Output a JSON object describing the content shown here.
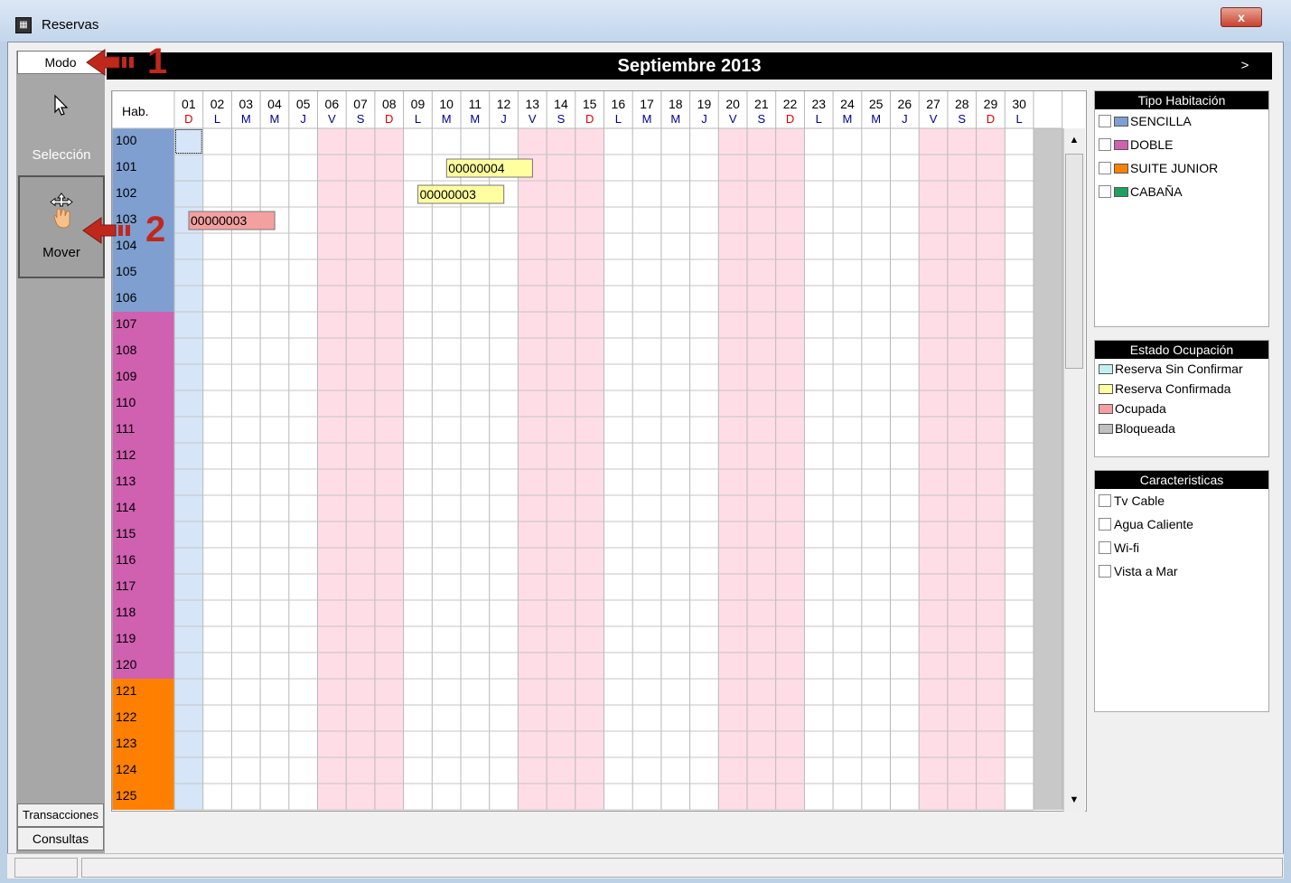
{
  "window": {
    "title": "Reservas",
    "close_label": "x"
  },
  "tabs": {
    "modo": "Modo",
    "transacciones": "Transacciones",
    "consultas": "Consultas"
  },
  "modes": {
    "seleccion": "Selección",
    "mover": "Mover"
  },
  "calendar": {
    "month_title": "Septiembre 2013",
    "next_label": ">",
    "room_header": "Hab.",
    "days": [
      {
        "n": "01",
        "w": "D"
      },
      {
        "n": "02",
        "w": "L"
      },
      {
        "n": "03",
        "w": "M"
      },
      {
        "n": "04",
        "w": "M"
      },
      {
        "n": "05",
        "w": "J"
      },
      {
        "n": "06",
        "w": "V"
      },
      {
        "n": "07",
        "w": "S"
      },
      {
        "n": "08",
        "w": "D"
      },
      {
        "n": "09",
        "w": "L"
      },
      {
        "n": "10",
        "w": "M"
      },
      {
        "n": "11",
        "w": "M"
      },
      {
        "n": "12",
        "w": "J"
      },
      {
        "n": "13",
        "w": "V"
      },
      {
        "n": "14",
        "w": "S"
      },
      {
        "n": "15",
        "w": "D"
      },
      {
        "n": "16",
        "w": "L"
      },
      {
        "n": "17",
        "w": "M"
      },
      {
        "n": "18",
        "w": "M"
      },
      {
        "n": "19",
        "w": "J"
      },
      {
        "n": "20",
        "w": "V"
      },
      {
        "n": "21",
        "w": "S"
      },
      {
        "n": "22",
        "w": "D"
      },
      {
        "n": "23",
        "w": "L"
      },
      {
        "n": "24",
        "w": "M"
      },
      {
        "n": "25",
        "w": "M"
      },
      {
        "n": "26",
        "w": "J"
      },
      {
        "n": "27",
        "w": "V"
      },
      {
        "n": "28",
        "w": "S"
      },
      {
        "n": "29",
        "w": "D"
      },
      {
        "n": "30",
        "w": "L"
      }
    ],
    "weekend_days": [
      "06",
      "07",
      "08",
      "13",
      "14",
      "15",
      "20",
      "21",
      "22",
      "27",
      "28",
      "29"
    ],
    "rooms": [
      {
        "num": "100",
        "type": "SENCILLA"
      },
      {
        "num": "101",
        "type": "SENCILLA"
      },
      {
        "num": "102",
        "type": "SENCILLA"
      },
      {
        "num": "103",
        "type": "SENCILLA"
      },
      {
        "num": "104",
        "type": "SENCILLA"
      },
      {
        "num": "105",
        "type": "SENCILLA"
      },
      {
        "num": "106",
        "type": "SENCILLA"
      },
      {
        "num": "107",
        "type": "DOBLE"
      },
      {
        "num": "108",
        "type": "DOBLE"
      },
      {
        "num": "109",
        "type": "DOBLE"
      },
      {
        "num": "110",
        "type": "DOBLE"
      },
      {
        "num": "111",
        "type": "DOBLE"
      },
      {
        "num": "112",
        "type": "DOBLE"
      },
      {
        "num": "113",
        "type": "DOBLE"
      },
      {
        "num": "114",
        "type": "DOBLE"
      },
      {
        "num": "115",
        "type": "DOBLE"
      },
      {
        "num": "116",
        "type": "DOBLE"
      },
      {
        "num": "117",
        "type": "DOBLE"
      },
      {
        "num": "118",
        "type": "DOBLE"
      },
      {
        "num": "119",
        "type": "DOBLE"
      },
      {
        "num": "120",
        "type": "DOBLE"
      },
      {
        "num": "121",
        "type": "SUITE JUNIOR"
      },
      {
        "num": "122",
        "type": "SUITE JUNIOR"
      },
      {
        "num": "123",
        "type": "SUITE JUNIOR"
      },
      {
        "num": "124",
        "type": "SUITE JUNIOR"
      },
      {
        "num": "125",
        "type": "SUITE JUNIOR"
      }
    ],
    "reservations": [
      {
        "code": "00000004",
        "room": "101",
        "start": "10",
        "days": 3,
        "state": "Reserva Confirmada"
      },
      {
        "code": "00000003",
        "room": "102",
        "start": "09",
        "days": 3,
        "state": "Reserva Confirmada"
      },
      {
        "code": "00000003",
        "room": "103",
        "start": "01",
        "days": 3,
        "state": "Ocupada"
      }
    ]
  },
  "room_types": {
    "title": "Tipo Habitación",
    "items": [
      {
        "label": "SENCILLA",
        "color": "#7f9fd0"
      },
      {
        "label": "DOBLE",
        "color": "#d060b0"
      },
      {
        "label": "SUITE JUNIOR",
        "color": "#ff8000"
      },
      {
        "label": "CABAÑA",
        "color": "#20a060"
      }
    ]
  },
  "occupancy": {
    "title": "Estado Ocupación",
    "items": [
      {
        "label": "Reserva Sin Confirmar",
        "color": "#c0f0f0"
      },
      {
        "label": "Reserva Confirmada",
        "color": "#ffffa0"
      },
      {
        "label": "Ocupada",
        "color": "#f4a0a0"
      },
      {
        "label": "Bloqueada",
        "color": "#c0c0c0"
      }
    ]
  },
  "features": {
    "title": "Caracteristicas",
    "items": [
      "Tv Cable",
      "Agua Caliente",
      "Wi-fi",
      "Vista a Mar"
    ]
  },
  "annotations": {
    "one": "1",
    "two": "2"
  },
  "colors": {
    "weekend": "#ffdde6",
    "today_col": "#d6e6f8",
    "day_red": "#e00000",
    "day_blue": "#00008b"
  }
}
